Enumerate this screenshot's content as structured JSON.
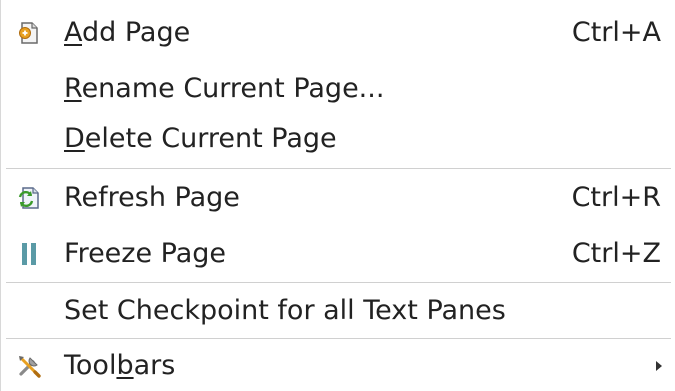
{
  "menu": {
    "items": [
      {
        "label_pre": "",
        "mnemonic": "A",
        "label_post": "dd Page",
        "shortcut": "Ctrl+A",
        "icon": "add-page-icon"
      },
      {
        "label_pre": "",
        "mnemonic": "R",
        "label_post": "ename Current Page...",
        "shortcut": "",
        "icon": ""
      },
      {
        "label_pre": "",
        "mnemonic": "D",
        "label_post": "elete Current Page",
        "shortcut": "",
        "icon": ""
      },
      {
        "label_pre": "Refresh Page",
        "mnemonic": "",
        "label_post": "",
        "shortcut": "Ctrl+R",
        "icon": "refresh-page-icon"
      },
      {
        "label_pre": "Freeze Page",
        "mnemonic": "",
        "label_post": "",
        "shortcut": "Ctrl+Z",
        "icon": "pause-icon"
      },
      {
        "label_pre": "Set Checkpoint for all Text Panes",
        "mnemonic": "",
        "label_post": "",
        "shortcut": "",
        "icon": ""
      },
      {
        "label_pre": "Tool",
        "mnemonic": "b",
        "label_post": "ars",
        "shortcut": "",
        "icon": "tools-icon",
        "has_submenu": true
      }
    ]
  },
  "colors": {
    "text": "#222222",
    "separator": "#d0d0d0",
    "freeze_icon": "#5a9aa6",
    "refresh_icon_green": "#3a9a2a",
    "add_icon_orange": "#e8a020"
  }
}
